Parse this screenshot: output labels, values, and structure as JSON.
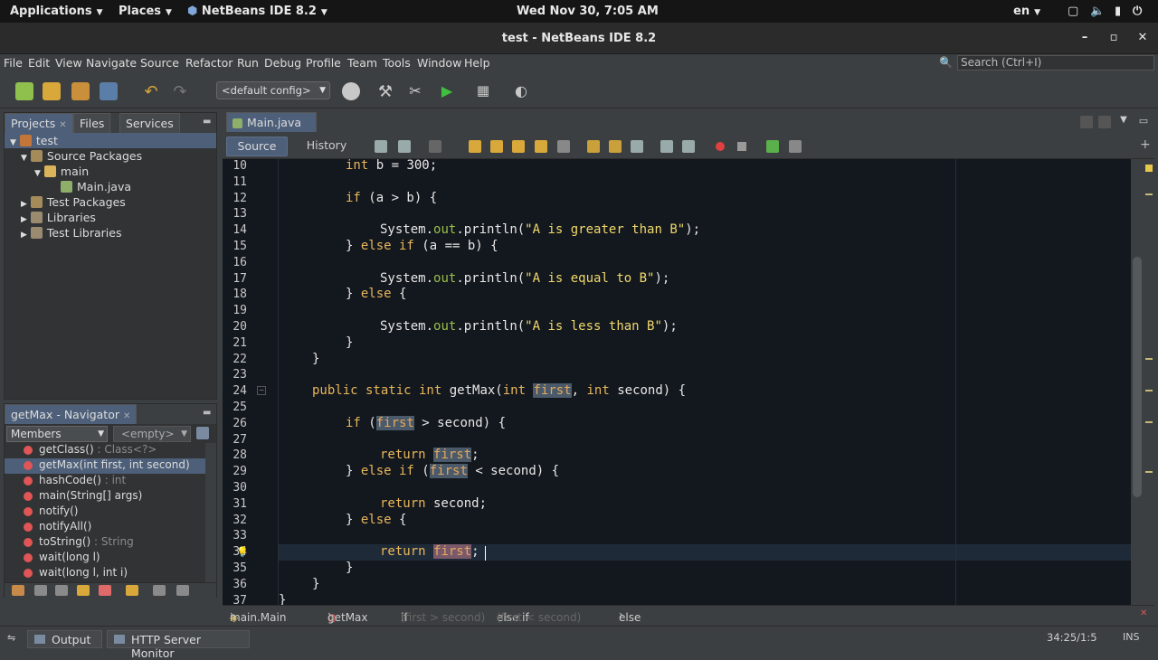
{
  "system_bar": {
    "applications": "Applications",
    "places": "Places",
    "active_app": "NetBeans IDE 8.2",
    "clock": "Wed Nov 30,  7:05 AM",
    "language": "en"
  },
  "window": {
    "title": "test - NetBeans IDE 8.2"
  },
  "menu": [
    "File",
    "Edit",
    "View",
    "Navigate",
    "Source",
    "Refactor",
    "Run",
    "Debug",
    "Profile",
    "Team",
    "Tools",
    "Window",
    "Help"
  ],
  "search": {
    "placeholder": "Search (Ctrl+I)"
  },
  "toolbar": {
    "config": "<default config>"
  },
  "projects_panel": {
    "tabs": [
      "Projects",
      "Files",
      "Services"
    ],
    "tree": [
      {
        "label": "test",
        "indent": 0
      },
      {
        "label": "Source Packages",
        "indent": 1
      },
      {
        "label": "main",
        "indent": 2
      },
      {
        "label": "Main.java",
        "indent": 3
      },
      {
        "label": "Test Packages",
        "indent": 1
      },
      {
        "label": "Libraries",
        "indent": 1
      },
      {
        "label": "Test Libraries",
        "indent": 1
      }
    ]
  },
  "navigator": {
    "title": "getMax - Navigator",
    "filter": "Members",
    "empty": "<empty>",
    "items": [
      {
        "name": "getClass()",
        "ret": " : Class<?>"
      },
      {
        "name": "getMax(int first, int second)",
        "ret": ""
      },
      {
        "name": "hashCode()",
        "ret": " : int"
      },
      {
        "name": "main(String[] args)",
        "ret": ""
      },
      {
        "name": "notify()",
        "ret": ""
      },
      {
        "name": "notifyAll()",
        "ret": ""
      },
      {
        "name": "toString()",
        "ret": " : String"
      },
      {
        "name": "wait(long l)",
        "ret": ""
      },
      {
        "name": "wait(long l, int i)",
        "ret": ""
      }
    ]
  },
  "editor": {
    "tab": "Main.java",
    "mode_tabs": [
      "Source",
      "History"
    ],
    "line_numbers": [
      "10",
      "11",
      "12",
      "13",
      "14",
      "15",
      "16",
      "17",
      "18",
      "19",
      "20",
      "21",
      "22",
      "23",
      "24",
      "25",
      "26",
      "27",
      "28",
      "29",
      "30",
      "31",
      "32",
      "33",
      "34",
      "35",
      "36",
      "37"
    ],
    "code": {
      "l10a": "int",
      "l10b": " b = 300;",
      "l12a": "if",
      "l12b": " (a > b) {",
      "l14a": "System.",
      "l14b": "out",
      "l14c": ".println(",
      "l14d": "\"A is greater than B\"",
      "l14e": ");",
      "l15a": "} ",
      "l15b": "else if",
      "l15c": " (a == b) {",
      "l17a": "System.",
      "l17b": "out",
      "l17c": ".println(",
      "l17d": "\"A is equal to B\"",
      "l17e": ");",
      "l18a": "} ",
      "l18b": "else",
      "l18c": " {",
      "l20a": "System.",
      "l20b": "out",
      "l20c": ".println(",
      "l20d": "\"A is less than B\"",
      "l20e": ");",
      "l21": "}",
      "l22": "}",
      "l24a": "public static int",
      "l24b": " getMax(",
      "l24c": "int",
      "l24d": " ",
      "l24e": "first",
      "l24f": ", ",
      "l24g": "int",
      "l24h": " second) {",
      "l26a": "if",
      "l26b": " (",
      "l26c": "first",
      "l26d": " > second) {",
      "l28a": "return",
      "l28b": " ",
      "l28c": "first",
      "l28d": ";",
      "l29a": "} ",
      "l29b": "else if",
      "l29c": " (",
      "l29d": "first",
      "l29e": " < second) {",
      "l31a": "return",
      "l31b": " second;",
      "l32a": "} ",
      "l32b": "else",
      "l32c": " {",
      "l34a": "return",
      "l34b": " ",
      "l34c": "first",
      "l34d": ";",
      "l35": "}",
      "l36": "}",
      "l37": "}"
    },
    "breadcrumb": {
      "class": "main.Main",
      "method": "getMax",
      "if": "if",
      "if_cond": "(first > second)",
      "elseif": "else if",
      "elseif_cond": "(first < second)",
      "else": "else"
    }
  },
  "status_bar": {
    "output": "Output",
    "http": "HTTP Server Monitor",
    "position": "34:25/1:5",
    "mode": "INS"
  }
}
